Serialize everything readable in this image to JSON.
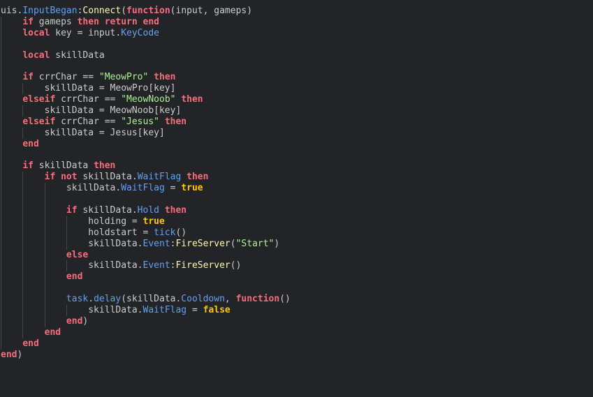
{
  "editor": {
    "colors": {
      "background": "#232428",
      "text": "#cccccc",
      "keyword": "#f86d7c",
      "boolean": "#ffc600",
      "property": "#61a1f1",
      "function": "#fdfbac",
      "string": "#adf195",
      "indent_guide": "#43454c"
    },
    "lines": [
      {
        "indent": 0,
        "tokens": [
          [
            "text",
            "uis."
          ],
          [
            "prop",
            "InputBegan"
          ],
          [
            "text",
            ":"
          ],
          [
            "fn",
            "Connect"
          ],
          [
            "text",
            "("
          ],
          [
            "kw",
            "function"
          ],
          [
            "text",
            "(input, gameps)"
          ]
        ]
      },
      {
        "indent": 1,
        "tokens": [
          [
            "kw",
            "if"
          ],
          [
            "text",
            " gameps "
          ],
          [
            "kw",
            "then"
          ],
          [
            "text",
            " "
          ],
          [
            "kw",
            "return"
          ],
          [
            "text",
            " "
          ],
          [
            "kw",
            "end"
          ]
        ]
      },
      {
        "indent": 1,
        "tokens": [
          [
            "kw",
            "local"
          ],
          [
            "text",
            " key = input."
          ],
          [
            "prop",
            "KeyCode"
          ]
        ]
      },
      {
        "indent": 1,
        "tokens": []
      },
      {
        "indent": 1,
        "tokens": [
          [
            "kw",
            "local"
          ],
          [
            "text",
            " skillData"
          ]
        ]
      },
      {
        "indent": 1,
        "tokens": []
      },
      {
        "indent": 1,
        "tokens": [
          [
            "kw",
            "if"
          ],
          [
            "text",
            " crrChar == "
          ],
          [
            "str",
            "\"MeowPro\""
          ],
          [
            "text",
            " "
          ],
          [
            "kw",
            "then"
          ]
        ]
      },
      {
        "indent": 2,
        "tokens": [
          [
            "text",
            "skillData = MeowPro[key]"
          ]
        ]
      },
      {
        "indent": 1,
        "tokens": [
          [
            "kw",
            "elseif"
          ],
          [
            "text",
            " crrChar == "
          ],
          [
            "str",
            "\"MeowNoob\""
          ],
          [
            "text",
            " "
          ],
          [
            "kw",
            "then"
          ]
        ]
      },
      {
        "indent": 2,
        "tokens": [
          [
            "text",
            "skillData = MeowNoob[key]"
          ]
        ]
      },
      {
        "indent": 1,
        "tokens": [
          [
            "kw",
            "elseif"
          ],
          [
            "text",
            " crrChar == "
          ],
          [
            "str",
            "\"Jesus\""
          ],
          [
            "text",
            " "
          ],
          [
            "kw",
            "then"
          ]
        ]
      },
      {
        "indent": 2,
        "tokens": [
          [
            "text",
            "skillData = Jesus[key]"
          ]
        ]
      },
      {
        "indent": 1,
        "tokens": [
          [
            "kw",
            "end"
          ]
        ]
      },
      {
        "indent": 1,
        "tokens": []
      },
      {
        "indent": 1,
        "tokens": [
          [
            "kw",
            "if"
          ],
          [
            "text",
            " skillData "
          ],
          [
            "kw",
            "then"
          ]
        ]
      },
      {
        "indent": 2,
        "tokens": [
          [
            "kw",
            "if"
          ],
          [
            "text",
            " "
          ],
          [
            "kw",
            "not"
          ],
          [
            "text",
            " skillData."
          ],
          [
            "prop",
            "WaitFlag"
          ],
          [
            "text",
            " "
          ],
          [
            "kw",
            "then"
          ]
        ]
      },
      {
        "indent": 3,
        "tokens": [
          [
            "text",
            "skillData."
          ],
          [
            "prop",
            "WaitFlag"
          ],
          [
            "text",
            " = "
          ],
          [
            "bool",
            "true"
          ]
        ]
      },
      {
        "indent": 3,
        "tokens": []
      },
      {
        "indent": 3,
        "tokens": [
          [
            "kw",
            "if"
          ],
          [
            "text",
            " skillData."
          ],
          [
            "prop",
            "Hold"
          ],
          [
            "text",
            " "
          ],
          [
            "kw",
            "then"
          ]
        ]
      },
      {
        "indent": 4,
        "tokens": [
          [
            "text",
            "holding = "
          ],
          [
            "bool",
            "true"
          ]
        ]
      },
      {
        "indent": 4,
        "tokens": [
          [
            "text",
            "holdstart = "
          ],
          [
            "prop",
            "tick"
          ],
          [
            "text",
            "()"
          ]
        ]
      },
      {
        "indent": 4,
        "tokens": [
          [
            "text",
            "skillData."
          ],
          [
            "prop",
            "Event"
          ],
          [
            "text",
            ":"
          ],
          [
            "fn",
            "FireServer"
          ],
          [
            "text",
            "("
          ],
          [
            "str",
            "\"Start\""
          ],
          [
            "text",
            ")"
          ]
        ]
      },
      {
        "indent": 3,
        "tokens": [
          [
            "kw",
            "else"
          ]
        ]
      },
      {
        "indent": 4,
        "tokens": [
          [
            "text",
            "skillData."
          ],
          [
            "prop",
            "Event"
          ],
          [
            "text",
            ":"
          ],
          [
            "fn",
            "FireServer"
          ],
          [
            "text",
            "()"
          ]
        ]
      },
      {
        "indent": 3,
        "tokens": [
          [
            "kw",
            "end"
          ]
        ]
      },
      {
        "indent": 3,
        "tokens": []
      },
      {
        "indent": 3,
        "tokens": [
          [
            "prop",
            "task"
          ],
          [
            "text",
            "."
          ],
          [
            "prop",
            "delay"
          ],
          [
            "text",
            "(skillData."
          ],
          [
            "prop",
            "Cooldown"
          ],
          [
            "text",
            ", "
          ],
          [
            "kw",
            "function"
          ],
          [
            "text",
            "()"
          ]
        ]
      },
      {
        "indent": 4,
        "tokens": [
          [
            "text",
            "skillData."
          ],
          [
            "prop",
            "WaitFlag"
          ],
          [
            "text",
            " = "
          ],
          [
            "bool",
            "false"
          ]
        ]
      },
      {
        "indent": 3,
        "tokens": [
          [
            "kw",
            "end"
          ],
          [
            "text",
            ")"
          ]
        ]
      },
      {
        "indent": 2,
        "tokens": [
          [
            "kw",
            "end"
          ]
        ]
      },
      {
        "indent": 1,
        "tokens": [
          [
            "kw",
            "end"
          ]
        ]
      },
      {
        "indent": 0,
        "tokens": [
          [
            "kw",
            "end"
          ],
          [
            "text",
            ")"
          ]
        ]
      }
    ]
  }
}
